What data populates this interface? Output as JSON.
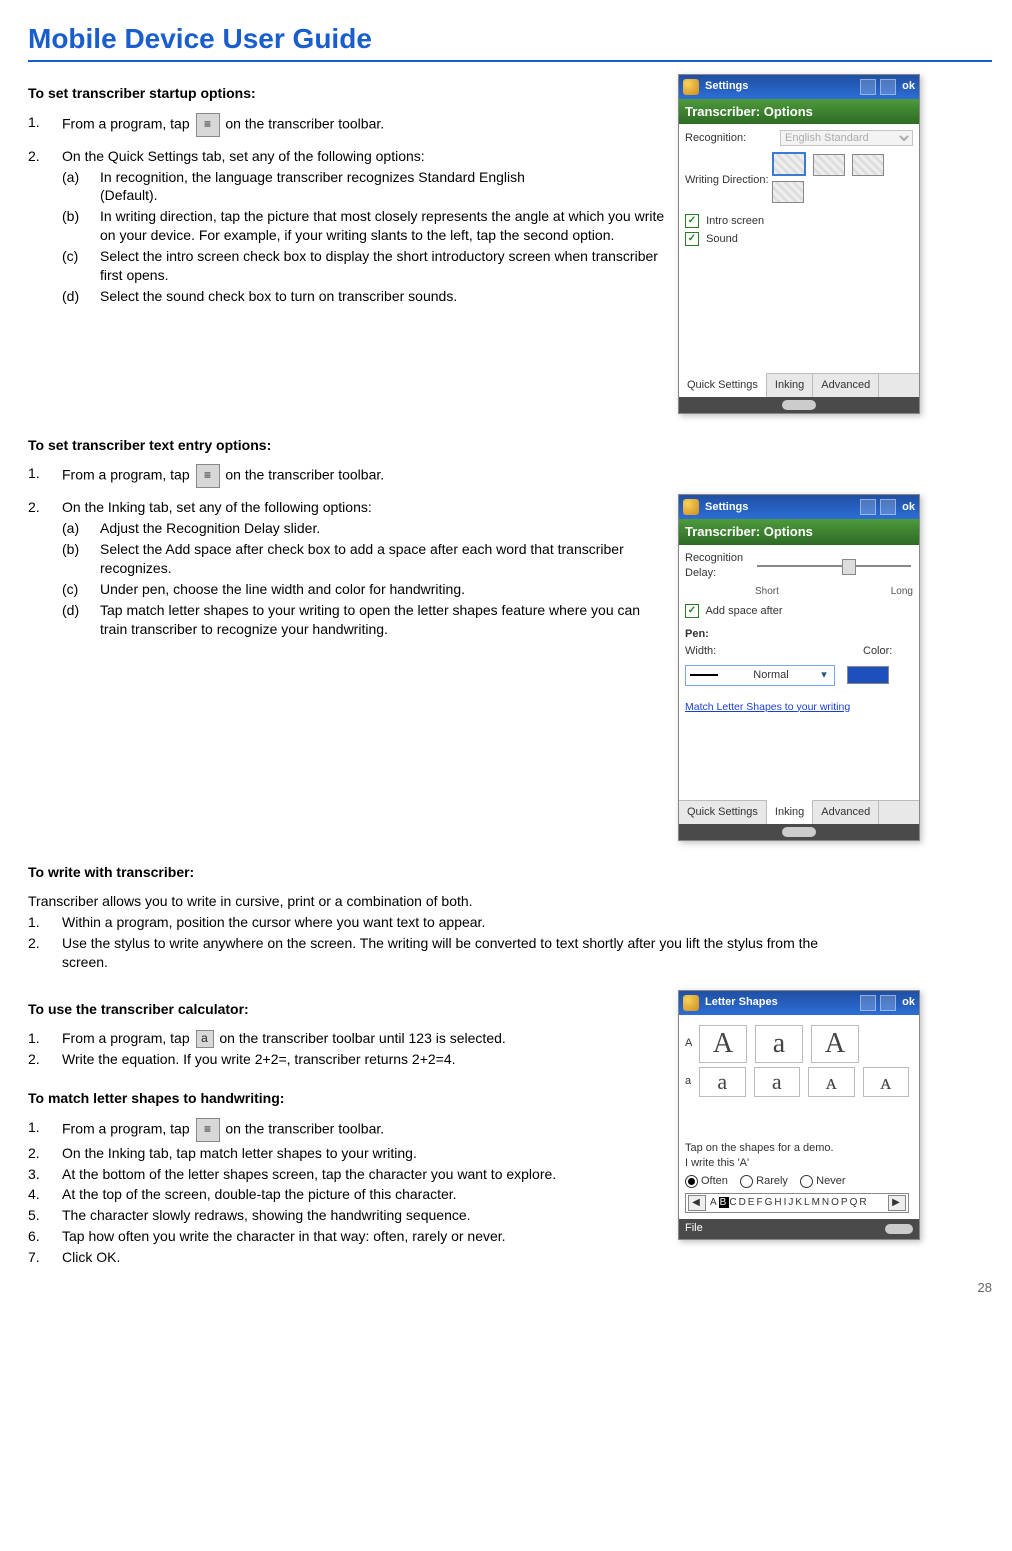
{
  "page": {
    "title": "Mobile Device User Guide",
    "page_number": "28"
  },
  "sections": {
    "startup": {
      "heading": "To set transcriber startup options:",
      "step1_pre": "From a program, tap",
      "step1_post": "on the transcriber toolbar.",
      "step2_intro": "On the Quick Settings tab, set any of the following options:",
      "a": "In recognition, the language transcriber recognizes Standard English\n(Default).",
      "b": "In writing direction, tap the picture that most closely represents the angle at which you write on your device. For example, if your writing slants to the left, tap the second option.",
      "c": "Select the intro screen check box to display the short introductory screen when transcriber first opens.",
      "d": "Select the sound check box to turn on transcriber sounds."
    },
    "text_entry": {
      "heading": "To set transcriber text entry options:",
      "step1_pre": "From a program, tap",
      "step1_post": "on the transcriber toolbar.",
      "step2_intro": "On the Inking tab, set any of the following options:",
      "a": "Adjust the Recognition Delay slider.",
      "b": "Select the Add space after check box to add a space after each word that transcriber recognizes.",
      "c": "Under pen, choose the line width and color for handwriting.",
      "d": "Tap match letter shapes to your writing to open the letter shapes feature where you can train transcriber to recognize your handwriting."
    },
    "write": {
      "heading": "To write with transcriber:",
      "intro": "Transcriber allows you to write in cursive, print or a combination of both.",
      "s1": "Within a program, position the cursor where you want text to appear.",
      "s2": "Use the stylus to write anywhere on the screen. The writing will be converted to text shortly after you lift the stylus from the screen."
    },
    "calc": {
      "heading": "To use the transcriber calculator:",
      "s1_pre": "From a program, tap",
      "s1_post": "on the transcriber toolbar until 123 is selected.",
      "s2": "Write the equation. If you write 2+2=, transcriber returns 2+2=4."
    },
    "shapes": {
      "heading": "To match letter shapes to handwriting:",
      "s1_pre": "From a program, tap",
      "s1_post": "on the transcriber toolbar.",
      "s2": "On the Inking tab, tap match letter shapes to your writing.",
      "s3": "At the bottom of the letter shapes screen, tap the character you want to explore.",
      "s4": "At the top of the screen, double-tap the picture of this character.",
      "s5": "The character slowly redraws, showing the handwriting sequence.",
      "s6": "Tap how often you write the character in that way: often, rarely or never.",
      "s7": "Click OK."
    }
  },
  "captures": {
    "quick_settings": {
      "title": "Settings",
      "subtitle": "Transcriber: Options",
      "ok": "ok",
      "recognition_label": "Recognition:",
      "recognition_value": "English Standard",
      "writing_dir_label": "Writing Direction:",
      "intro": "Intro screen",
      "sound": "Sound",
      "tab1": "Quick Settings",
      "tab2": "Inking",
      "tab3": "Advanced"
    },
    "inking": {
      "title": "Settings",
      "subtitle": "Transcriber: Options",
      "ok": "ok",
      "recog_delay": "Recognition Delay:",
      "short": "Short",
      "long": "Long",
      "add_space": "Add space after",
      "pen": "Pen:",
      "width": "Width:",
      "color": "Color:",
      "normal": "Normal",
      "link": "Match Letter Shapes to your writing",
      "tab1": "Quick Settings",
      "tab2": "Inking",
      "tab3": "Advanced"
    },
    "letter_shapes": {
      "title": "Letter Shapes",
      "ok": "ok",
      "upperA": "A",
      "lowera": "a",
      "demo_line1": "Tap on the shapes for a demo.",
      "demo_line2": "I write this 'A'",
      "often": "Often",
      "rarely": "Rarely",
      "never": "Never",
      "chars_prefix": "A",
      "chars_sel": "B",
      "chars_rest": "CDEFGHIJKLMNOPQR",
      "file": "File"
    }
  }
}
